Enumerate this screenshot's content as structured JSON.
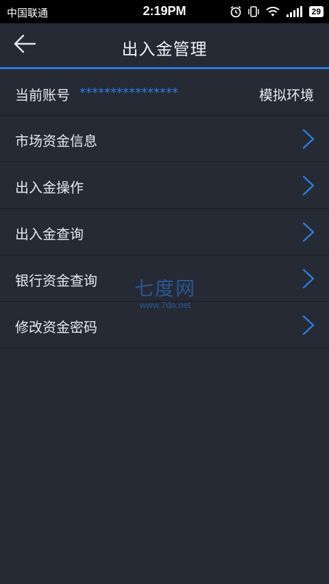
{
  "status_bar": {
    "carrier": "中国联通",
    "time": "2:19PM",
    "battery": "29",
    "icons": [
      "alarm-icon",
      "vibrate-icon",
      "wifi-icon",
      "signal-icon",
      "battery-icon"
    ]
  },
  "header": {
    "title": "出入金管理",
    "back_icon": "back-arrow-icon"
  },
  "account": {
    "label": "当前账号",
    "value": "****************",
    "environment": "模拟环境"
  },
  "menu": {
    "items": [
      {
        "label": "市场资金信息",
        "icon": "chevron-right-icon"
      },
      {
        "label": "出入金操作",
        "icon": "chevron-right-icon"
      },
      {
        "label": "出入金查询",
        "icon": "chevron-right-icon"
      },
      {
        "label": "银行资金查询",
        "icon": "chevron-right-icon"
      },
      {
        "label": "修改资金密码",
        "icon": "chevron-right-icon"
      }
    ]
  },
  "watermark": {
    "title": "七度网",
    "url": "www.7do.net"
  },
  "colors": {
    "background": "#262a35",
    "accent": "#2b7de0",
    "status_bar": "#000000",
    "divider": "#1a1d25"
  }
}
